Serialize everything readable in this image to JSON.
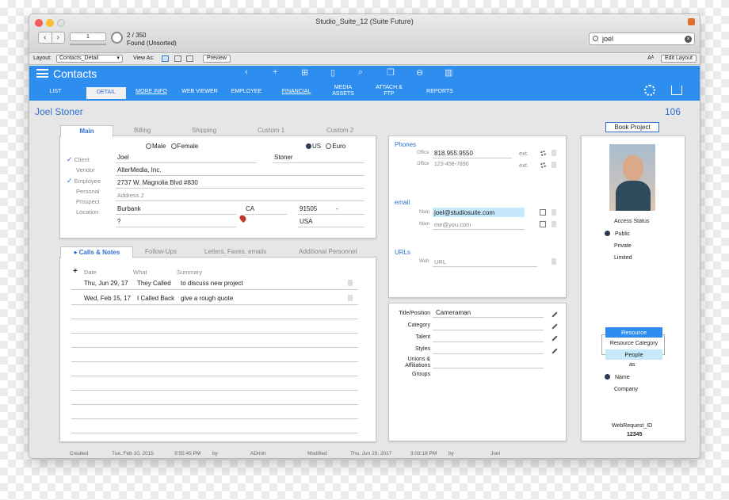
{
  "window": {
    "title": "Studio_Suite_12 (Suite Future)"
  },
  "toolbar": {
    "record": "1",
    "count": "2 / 350",
    "found": "Found (Unsorted)",
    "search_value": "joel"
  },
  "layoutbar": {
    "layout_label": "Layout:",
    "layout_value": "Contacts_Detail",
    "view_as": "View As:",
    "preview": "Preview",
    "edit_layout": "Edit Layout",
    "text_size": "Aᴬ"
  },
  "header": {
    "title": "Contacts",
    "tabs": [
      {
        "label": "LIST"
      },
      {
        "label": "DETAIL"
      },
      {
        "label": "MORE INFO"
      },
      {
        "label": "WEB VIEWER"
      },
      {
        "label": "EMPLOYEE"
      },
      {
        "label": "FINANCIAL"
      },
      {
        "label": "MEDIA ASSETS"
      },
      {
        "label": "ATTACH & FTP"
      },
      {
        "label": "REPORTS"
      }
    ]
  },
  "contact": {
    "name": "Joel Stoner",
    "id": "106",
    "book_project": "Book Project"
  },
  "main_panel": {
    "tabs": [
      "Main",
      "Billing",
      "Shipping",
      "Custom 1",
      "Custom 2"
    ],
    "gender_male": "Male",
    "gender_female": "Female",
    "country_us": "US",
    "country_euro": "Euro",
    "types": [
      "Client",
      "Vendor",
      "Employee",
      "Personal",
      "Prospect",
      "Location"
    ],
    "first": "Joel",
    "last": "Stoner",
    "company": "AlterMedia, Inc.",
    "address1": "2737 W. Magnolia Blvd #830",
    "address2": "Address 2",
    "city": "Burbank",
    "state": "CA",
    "zip": "91505",
    "zip_dash": "-",
    "unknown": "?",
    "country": "USA"
  },
  "notes_panel": {
    "tabs": [
      "Calls & Notes",
      "Follow-Ups",
      "Letters, Faxes, emails",
      "Additional Personnel"
    ],
    "headers": [
      "Date",
      "What",
      "Summary"
    ],
    "add": "+",
    "rows": [
      {
        "date": "Thu, Jun 29, 17",
        "what": "They Called",
        "summary": "to discuss new project"
      },
      {
        "date": "Wed, Feb 15, 17",
        "what": "I Called Back",
        "summary": "give a rough quote"
      }
    ]
  },
  "phones": {
    "title": "Phones",
    "rows": [
      {
        "label": "Office",
        "value": "818.955.9550",
        "ext": "ext."
      },
      {
        "label": "Office",
        "value": "123-456-7890",
        "ext": "ext."
      }
    ],
    "email_title": "email",
    "emails": [
      {
        "label": "Main",
        "value": "joel@studiosuite.com"
      },
      {
        "label": "Main",
        "value": "me@you.com"
      }
    ],
    "urls_title": "URLs",
    "url_label": "Web",
    "url_value": "URL"
  },
  "details": {
    "rows": [
      {
        "label": "Title/Position",
        "value": "Cameraman"
      },
      {
        "label": "Category",
        "value": ""
      },
      {
        "label": "Talent",
        "value": ""
      },
      {
        "label": "Styles",
        "value": ""
      },
      {
        "label": "Unions & Affiliations",
        "value": ""
      },
      {
        "label": "Groups",
        "value": ""
      }
    ]
  },
  "side": {
    "access_status": "Access Status",
    "public": "Public",
    "private": "Private",
    "limited": "Limited",
    "resource": "Resource",
    "resource_category": "Resource Category",
    "people": "People",
    "as": "as",
    "name": "Name",
    "company": "Company",
    "web_request": "WebRequest_ID",
    "web_request_value": "12345"
  },
  "footer": {
    "created": "Created",
    "created_date": "Tue, Feb 10, 2015",
    "created_time": "3:55:45 PM",
    "by1": "by",
    "created_by": "ADmin",
    "modified": "Modified",
    "modified_date": "Thu, Jun 29, 2017",
    "modified_time": "3:03:18 PM",
    "by2": "by",
    "modified_by": "Joel"
  },
  "colors": {
    "accent": "#2e8ef0",
    "link": "#2e6fd1",
    "highlight": "#c6e8fb"
  }
}
